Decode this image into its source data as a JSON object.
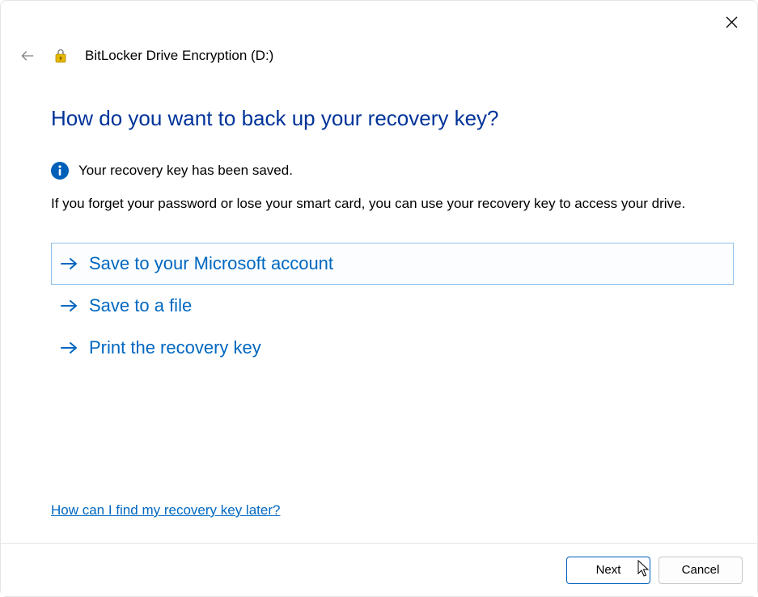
{
  "window": {
    "title": "BitLocker Drive Encryption (D:)"
  },
  "heading": "How do you want to back up your recovery key?",
  "info": {
    "saved": "Your recovery key has been saved.",
    "description": "If you forget your password or lose your smart card, you can use your recovery key to access your drive."
  },
  "options": [
    {
      "label": "Save to your Microsoft account",
      "selected": true
    },
    {
      "label": "Save to a file",
      "selected": false
    },
    {
      "label": "Print the recovery key",
      "selected": false
    }
  ],
  "help_link": "How can I find my recovery key later?",
  "buttons": {
    "next": "Next",
    "cancel": "Cancel"
  }
}
